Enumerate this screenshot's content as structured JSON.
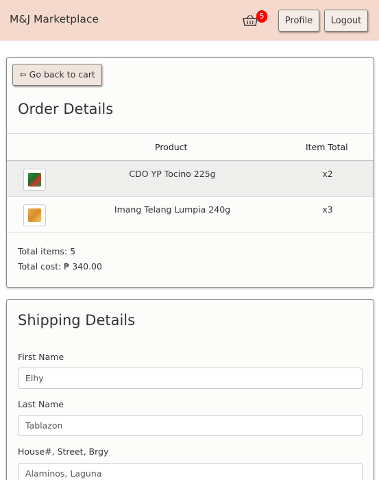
{
  "navbar": {
    "brand": "M&J Marketplace",
    "cart_count": "5",
    "profile_label": "Profile",
    "logout_label": "Logout"
  },
  "order": {
    "back_label": "⇦ Go back to cart",
    "title": "Order Details",
    "columns": [
      "Product",
      "Item Total"
    ],
    "items": [
      {
        "name": "CDO YP Tocino 225g",
        "qty": "x2"
      },
      {
        "name": "Imang Telang Lumpia 240g",
        "qty": "x3"
      }
    ],
    "total_items": "Total items: 5",
    "total_cost": "Total cost: ₱ 340.00"
  },
  "shipping": {
    "title": "Shipping Details",
    "first_name_label": "First Name",
    "first_name_value": "Elhy",
    "last_name_label": "Last Name",
    "last_name_value": "Tablazon",
    "address_label": "House#, Street, Brgy",
    "address_value": "Alaminos, Laguna"
  },
  "colors": {
    "navbar_bg": "#f4d9cc",
    "badge": "#ff0000"
  }
}
